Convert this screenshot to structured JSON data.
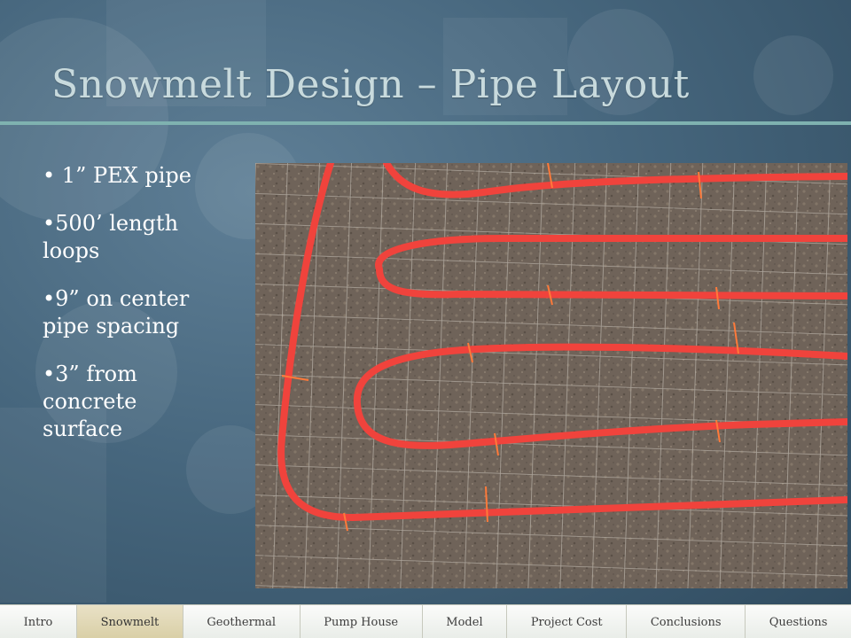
{
  "slide": {
    "title": "Snowmelt Design – Pipe Layout",
    "bullets": [
      "1” PEX pipe",
      "500’ length loops",
      "9” on center pipe spacing",
      "3” from concrete surface"
    ],
    "photo": {
      "subject": "red PEX pipe loops tied to wire mesh over gravel"
    }
  },
  "nav": {
    "tabs": [
      "Intro",
      "Snowmelt",
      "Geothermal",
      "Pump House",
      "Model",
      "Project Cost",
      "Conclusions",
      "Questions"
    ],
    "active": "Snowmelt"
  },
  "colors": {
    "background": "#46667d",
    "title": "#c8dadd",
    "rule": "#7fb2b0",
    "pipe": "#f0433c",
    "active_tab": "#ddd3ad"
  }
}
